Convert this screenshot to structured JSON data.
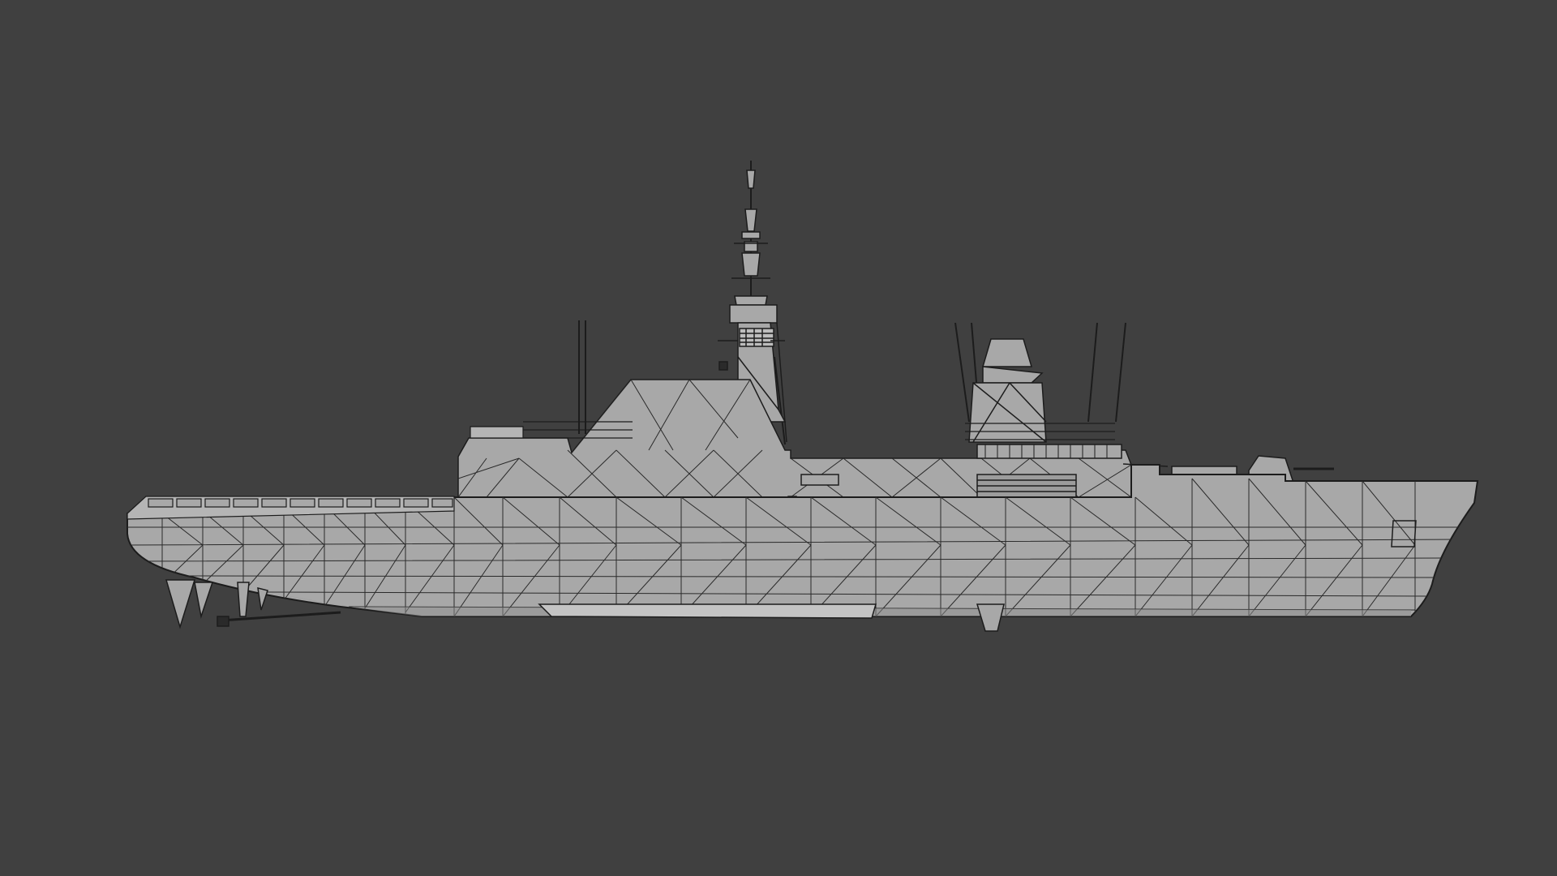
{
  "viewport": {
    "background_color": "#404040",
    "render_mode": "wireframe-on-shaded",
    "object": {
      "kind": "naval-frigate-3d-model",
      "surface_color": "#a8a8a8",
      "wire_color": "#1c1c1c",
      "highlight_color": "#c4c4c4",
      "shadow_color": "#8e8e8e"
    }
  }
}
